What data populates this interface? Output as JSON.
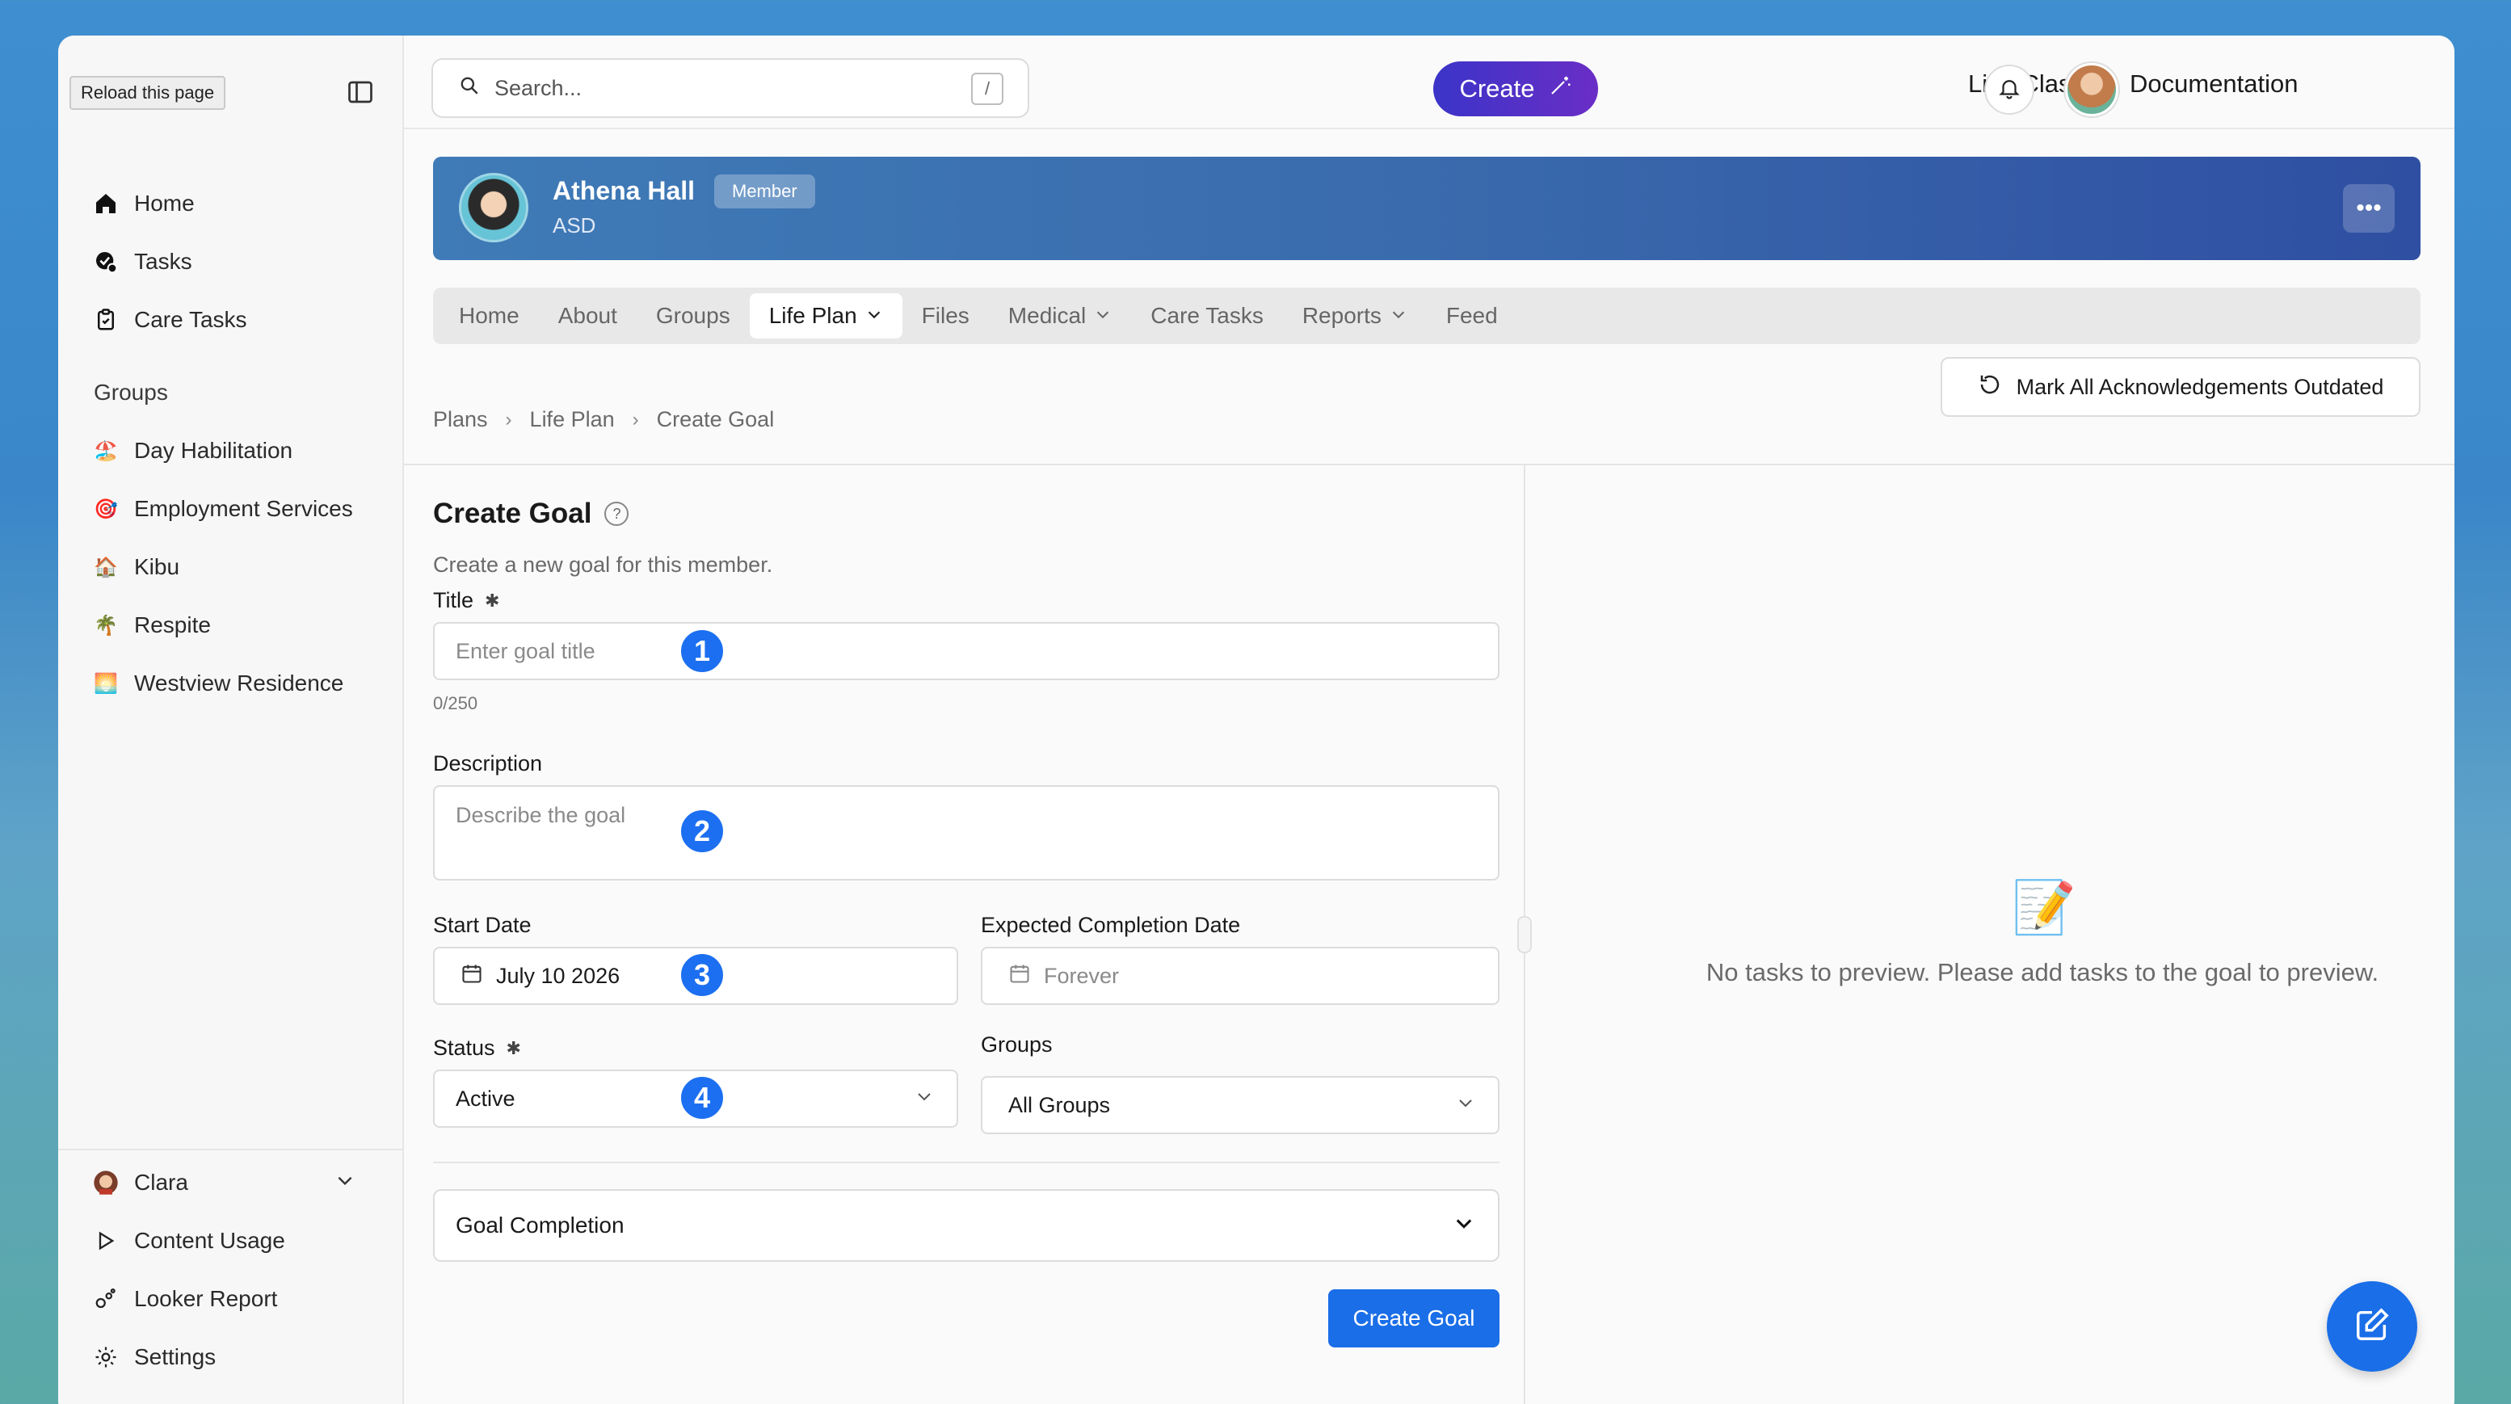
{
  "tooltip": "Reload this page",
  "sidebar": {
    "nav": [
      {
        "label": "Home",
        "icon": "home-icon"
      },
      {
        "label": "Tasks",
        "icon": "tasks-icon"
      },
      {
        "label": "Care Tasks",
        "icon": "clipboard-icon"
      }
    ],
    "groups_title": "Groups",
    "groups": [
      {
        "label": "Day Habilitation",
        "emoji": "🏖️"
      },
      {
        "label": "Employment Services",
        "emoji": "🎯"
      },
      {
        "label": "Kibu",
        "emoji": "🏠"
      },
      {
        "label": "Respite",
        "emoji": "🌴"
      },
      {
        "label": "Westview Residence",
        "emoji": "🌅"
      }
    ],
    "bottom": [
      {
        "label": "Clara",
        "icon": "user-avatar-icon"
      },
      {
        "label": "Content Usage",
        "icon": "play-icon"
      },
      {
        "label": "Looker Report",
        "icon": "looker-icon"
      },
      {
        "label": "Settings",
        "icon": "gear-icon"
      }
    ]
  },
  "topbar": {
    "search_placeholder": "Search...",
    "search_shortcut": "/",
    "create_label": "Create",
    "links": [
      "Live Classes",
      "Documentation"
    ]
  },
  "member": {
    "name": "Athena Hall",
    "role_badge": "Member",
    "subtitle": "ASD"
  },
  "tabs": [
    {
      "label": "Home",
      "dropdown": false
    },
    {
      "label": "About",
      "dropdown": false
    },
    {
      "label": "Groups",
      "dropdown": false
    },
    {
      "label": "Life Plan",
      "dropdown": true,
      "active": true
    },
    {
      "label": "Files",
      "dropdown": false
    },
    {
      "label": "Medical",
      "dropdown": true
    },
    {
      "label": "Care Tasks",
      "dropdown": false
    },
    {
      "label": "Reports",
      "dropdown": true
    },
    {
      "label": "Feed",
      "dropdown": false
    }
  ],
  "breadcrumb": [
    "Plans",
    "Life Plan",
    "Create Goal"
  ],
  "ack_button": "Mark All Acknowledgements Outdated",
  "form": {
    "title": "Create Goal",
    "subtitle": "Create a new goal for this member.",
    "title_label": "Title",
    "title_placeholder": "Enter goal title",
    "title_counter": "0/250",
    "description_label": "Description",
    "description_placeholder": "Describe the goal",
    "start_date_label": "Start Date",
    "start_date_value": "July 10 2026",
    "completion_label": "Expected Completion Date",
    "completion_placeholder": "Forever",
    "status_label": "Status",
    "status_value": "Active",
    "groups_label": "Groups",
    "groups_value": "All Groups",
    "accordion_label": "Goal Completion",
    "submit_label": "Create Goal",
    "markers": [
      "1",
      "2",
      "3",
      "4"
    ]
  },
  "preview": {
    "emoji": "📝",
    "empty_text": "No tasks to preview. Please add tasks to the goal to preview."
  }
}
